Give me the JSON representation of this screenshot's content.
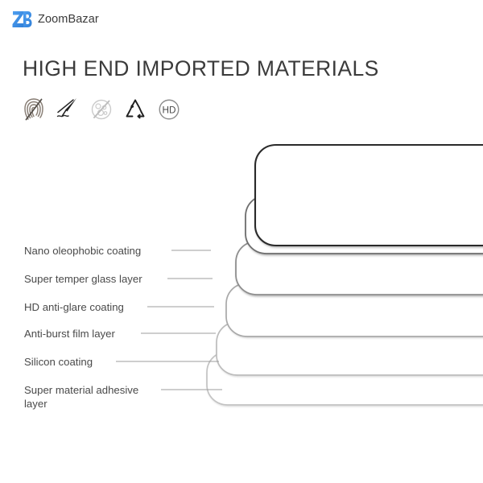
{
  "brand": {
    "name": "ZoomBazar",
    "logo_icon": "zb-monogram-icon",
    "logo_color": "#3b8ee8"
  },
  "header": {
    "title": "HIGH END IMPORTED MATERIALS"
  },
  "feature_icons": [
    {
      "name": "anti-fingerprint-icon",
      "label": "Anti-fingerprint"
    },
    {
      "name": "scratch-resistant-knife-icon",
      "label": "Scratch resistant"
    },
    {
      "name": "no-bubble-icon",
      "label": "Bubble free"
    },
    {
      "name": "recycle-icon",
      "label": "Recyclable"
    },
    {
      "name": "hd-icon",
      "label": "HD"
    }
  ],
  "diagram": {
    "type": "layer-stack",
    "line_color_dark": "#2b2b2b",
    "line_color_light": "#b9b9b9",
    "leader_color": "#9a9a9a",
    "layers": [
      {
        "label": "Nano oleophobic coating",
        "order": 1
      },
      {
        "label": "Super temper glass layer",
        "order": 2
      },
      {
        "label": "HD anti-glare coating",
        "order": 3
      },
      {
        "label": "Anti-burst film layer",
        "order": 4
      },
      {
        "label": "Silicon coating",
        "order": 5
      },
      {
        "label": "Super material adhesive layer",
        "order": 6
      }
    ]
  }
}
